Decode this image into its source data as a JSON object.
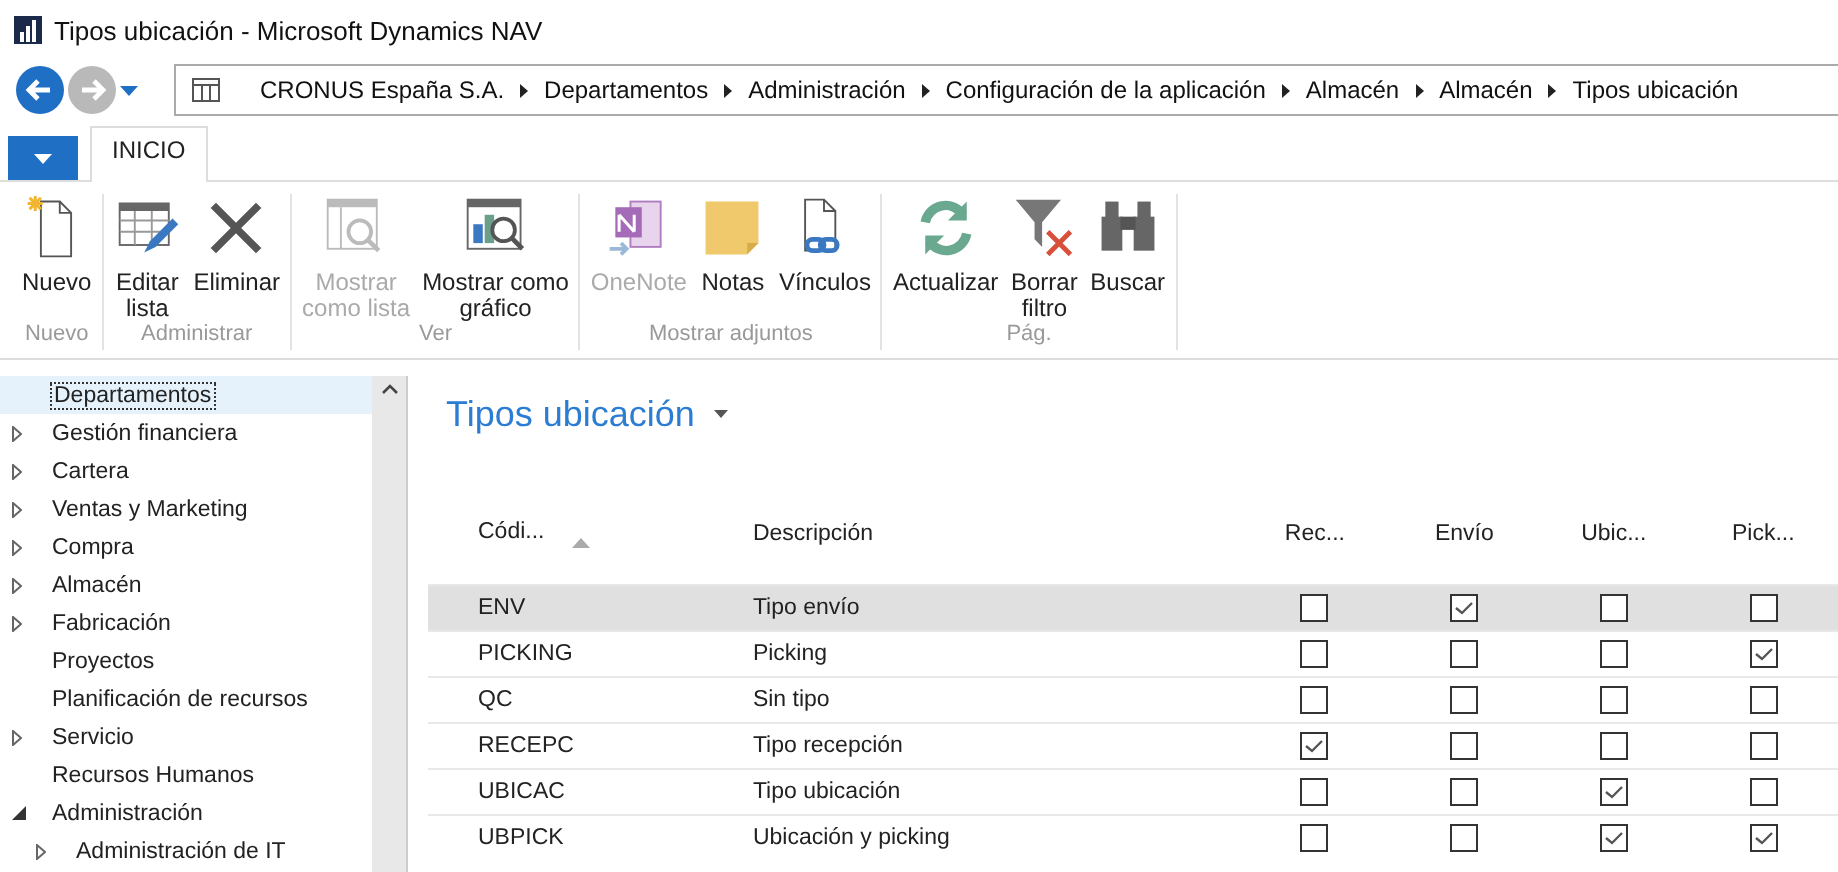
{
  "window": {
    "title": "Tipos ubicación - Microsoft Dynamics NAV"
  },
  "breadcrumb": [
    "CRONUS España S.A.",
    "Departamentos",
    "Administración",
    "Configuración de la aplicación",
    "Almacén",
    "Almacén",
    "Tipos ubicación"
  ],
  "tabs": [
    {
      "label": "INICIO",
      "selected": true
    }
  ],
  "ribbon": [
    {
      "label": "Nuevo",
      "actions": [
        {
          "label": "Nuevo",
          "disabled": false
        }
      ]
    },
    {
      "label": "Administrar",
      "actions": [
        {
          "label": "Editar\nlista",
          "disabled": false
        },
        {
          "label": "Eliminar",
          "disabled": false
        }
      ]
    },
    {
      "label": "Ver",
      "actions": [
        {
          "label": "Mostrar\ncomo lista",
          "disabled": true
        },
        {
          "label": "Mostrar como\ngráfico",
          "disabled": false
        }
      ]
    },
    {
      "label": "Mostrar adjuntos",
      "actions": [
        {
          "label": "OneNote",
          "disabled": true
        },
        {
          "label": "Notas",
          "disabled": false
        },
        {
          "label": "Vínculos",
          "disabled": false
        }
      ]
    },
    {
      "label": "Pág.",
      "actions": [
        {
          "label": "Actualizar",
          "disabled": false
        },
        {
          "label": "Borrar\nfiltro",
          "disabled": false
        },
        {
          "label": "Buscar",
          "disabled": false
        }
      ]
    }
  ],
  "navigation": [
    {
      "label": "Departamentos",
      "selected": true
    },
    {
      "label": "Gestión financiera",
      "selected": false,
      "expanded": false
    },
    {
      "label": "Cartera",
      "selected": false,
      "expanded": false
    },
    {
      "label": "Ventas y Marketing",
      "selected": false,
      "expanded": false
    },
    {
      "label": "Compra",
      "selected": false,
      "expanded": false
    },
    {
      "label": "Almacén",
      "selected": false,
      "expanded": false
    },
    {
      "label": "Fabricación",
      "selected": false,
      "expanded": false
    },
    {
      "label": "Proyectos",
      "selected": false
    },
    {
      "label": "Planificación de recursos",
      "selected": false
    },
    {
      "label": "Servicio",
      "selected": false,
      "expanded": false
    },
    {
      "label": "Recursos Humanos",
      "selected": false
    },
    {
      "label": "Administración",
      "selected": false,
      "expanded": true,
      "children": [
        {
          "label": "Administración de IT",
          "selected": false,
          "expanded": false
        }
      ]
    }
  ],
  "page": {
    "title": "Tipos ubicación",
    "table": {
      "columns": [
        {
          "label": "Códi...",
          "kind": "text",
          "sorted": true
        },
        {
          "label": "Descripción",
          "kind": "text",
          "sorted": false
        },
        {
          "label": "Rec...",
          "kind": "check",
          "sorted": false
        },
        {
          "label": "Envío",
          "kind": "check",
          "sorted": false
        },
        {
          "label": "Ubic...",
          "kind": "check",
          "sorted": false
        },
        {
          "label": "Pick...",
          "kind": "check",
          "sorted": false
        }
      ],
      "rows": [
        {
          "selected": true,
          "cells": [
            "ENV",
            "Tipo envío",
            false,
            true,
            false,
            false
          ]
        },
        {
          "selected": false,
          "cells": [
            "PICKING",
            "Picking",
            false,
            false,
            false,
            true
          ]
        },
        {
          "selected": false,
          "cells": [
            "QC",
            "Sin tipo",
            false,
            false,
            false,
            false
          ]
        },
        {
          "selected": false,
          "cells": [
            "RECEPC",
            "Tipo recepción",
            true,
            false,
            false,
            false
          ]
        },
        {
          "selected": false,
          "cells": [
            "UBICAC",
            "Tipo ubicación",
            false,
            false,
            true,
            false
          ]
        },
        {
          "selected": false,
          "cells": [
            "UBPICK",
            "Ubicación y picking",
            false,
            false,
            true,
            true
          ]
        }
      ]
    }
  }
}
